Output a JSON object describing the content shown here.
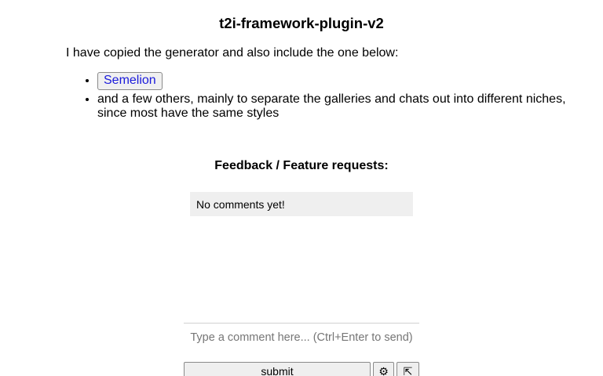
{
  "header": {
    "title": "t2i-framework-plugin-v2"
  },
  "content": {
    "intro": "I have copied the generator and also include the one below:",
    "list_items": [
      {
        "label": "Semelion",
        "is_link": true
      },
      {
        "label": "and a few others, mainly to separate the galleries and chats out into different niches, since most have the same styles",
        "is_link": false
      }
    ]
  },
  "feedback": {
    "heading": "Feedback / Feature requests:",
    "empty_message": "No comments yet!",
    "input_placeholder": "Type a comment here... (Ctrl+Enter to send)",
    "input_value": "",
    "submit_label": "submit",
    "settings_icon": "gear-icon",
    "settings_glyph": "⚙",
    "expand_icon": "expand-arrow-icon",
    "expand_glyph": "⇱"
  },
  "colors": {
    "link": "#1a1adb",
    "comment_box_bg": "#efefef",
    "button_bg": "#efefef"
  }
}
